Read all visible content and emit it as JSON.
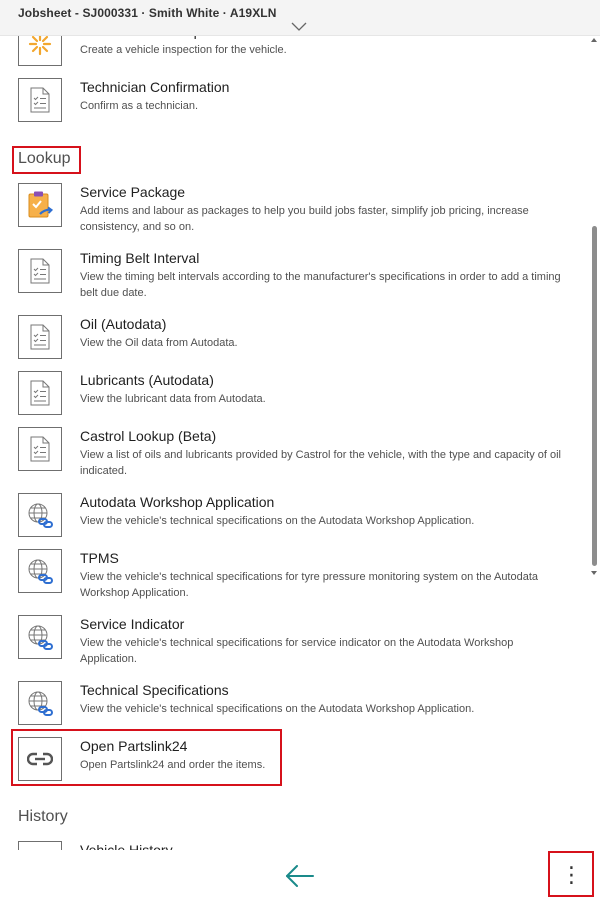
{
  "header": {
    "title": "Jobsheet - SJ000331 · Smith White · A19XLN"
  },
  "top_items": [
    {
      "title": "Create Vehicle Inspection",
      "desc": "Create a vehicle inspection for the vehicle.",
      "icon": "sun-icon"
    },
    {
      "title": "Technician Confirmation",
      "desc": "Confirm as a technician.",
      "icon": "document-checklist-icon"
    }
  ],
  "sections": {
    "lookup": "Lookup",
    "history": "History"
  },
  "lookup_items": [
    {
      "title": "Service Package",
      "desc": "Add items and labour as packages to help you build jobs faster, simplify job pricing, increase consistency, and so on.",
      "icon": "clipboard-package-icon"
    },
    {
      "title": "Timing Belt Interval",
      "desc": "View the timing belt intervals according to the manufacturer's specifications in order to add a timing belt due date.",
      "icon": "document-checklist-icon"
    },
    {
      "title": "Oil (Autodata)",
      "desc": "View the Oil data from Autodata.",
      "icon": "document-checklist-icon"
    },
    {
      "title": "Lubricants (Autodata)",
      "desc": "View the lubricant data from Autodata.",
      "icon": "document-checklist-icon"
    },
    {
      "title": "Castrol Lookup (Beta)",
      "desc": "View a list of oils and lubricants provided by Castrol for the vehicle, with the type and capacity of oil indicated.",
      "icon": "document-checklist-icon"
    },
    {
      "title": "Autodata Workshop Application",
      "desc": "View the vehicle's technical specifications on the Autodata Workshop Application.",
      "icon": "globe-link-icon"
    },
    {
      "title": "TPMS",
      "desc": "View the vehicle's technical specifications for tyre pressure monitoring system on the Autodata Workshop Application.",
      "icon": "globe-link-icon"
    },
    {
      "title": "Service Indicator",
      "desc": "View the vehicle's technical specifications for service indicator on the Autodata Workshop Application.",
      "icon": "globe-link-icon"
    },
    {
      "title": "Technical Specifications",
      "desc": "View the vehicle's technical specifications on the Autodata Workshop Application.",
      "icon": "globe-link-icon"
    },
    {
      "title": "Open Partslink24",
      "desc": "Open Partslink24 and order the items.",
      "icon": "link-icon"
    }
  ],
  "history_items": [
    {
      "title": "Vehicle History",
      "icon": "document-icon"
    }
  ],
  "footer": {
    "more_label": "⋮",
    "back_icon": "arrow-left-icon"
  },
  "colors": {
    "highlight": "#d6111b",
    "back_arrow": "#1a8a8a",
    "sun_icon": "#f2a72e"
  }
}
